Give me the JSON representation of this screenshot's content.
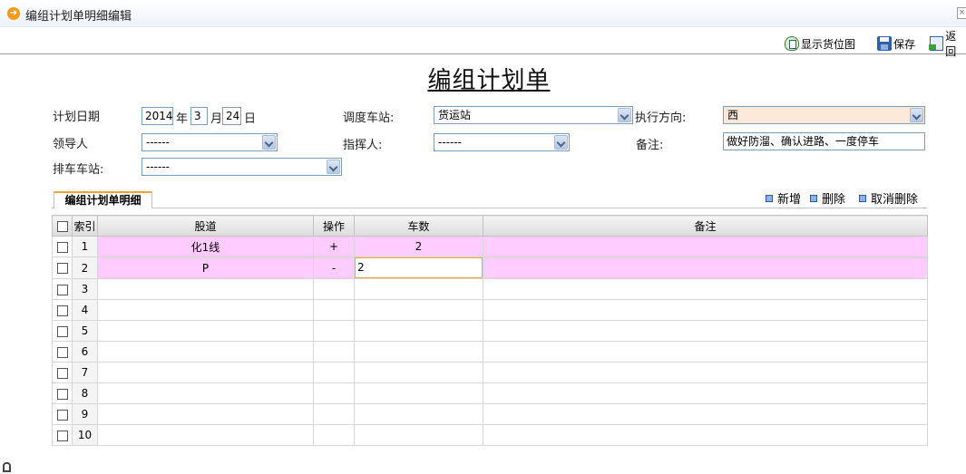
{
  "window": {
    "title": "编组计划单明细编辑"
  },
  "toolbar": {
    "show_map_label": "显示货位图",
    "save_label": "保存",
    "back_label": "返回"
  },
  "page": {
    "title": "编组计划单"
  },
  "form": {
    "plan_date_label": "计划日期",
    "year": "2014",
    "year_unit": "年",
    "month": "3",
    "month_unit": "月",
    "day": "24",
    "day_unit": "日",
    "dispatch_station_label": "调度车站:",
    "dispatch_station_value": "货运站",
    "direction_label": "执行方向:",
    "direction_value": "西",
    "leader_label": "领导人",
    "leader_value": "------",
    "commander_label": "指挥人:",
    "commander_value": "------",
    "remark_label": "备注:",
    "remark_value": "做好防溜、确认进路、一度停车",
    "arrange_station_label": "排车车站:",
    "arrange_station_value": "------"
  },
  "detail": {
    "tab_label": "编组计划单明细",
    "actions": {
      "add": "新增",
      "delete": "删除",
      "undo_delete": "取消删除"
    },
    "columns": {
      "index": "索引",
      "track": "股道",
      "operation": "操作",
      "car_count": "车数",
      "remark": "备注"
    },
    "rows": [
      {
        "index": "1",
        "track": "化1线",
        "operation": "+",
        "car_count": "2",
        "remark": ""
      },
      {
        "index": "2",
        "track": "P",
        "operation": "-",
        "car_count": "2",
        "remark": ""
      },
      {
        "index": "3",
        "track": "",
        "operation": "",
        "car_count": "",
        "remark": ""
      },
      {
        "index": "4",
        "track": "",
        "operation": "",
        "car_count": "",
        "remark": ""
      },
      {
        "index": "5",
        "track": "",
        "operation": "",
        "car_count": "",
        "remark": ""
      },
      {
        "index": "6",
        "track": "",
        "operation": "",
        "car_count": "",
        "remark": ""
      },
      {
        "index": "7",
        "track": "",
        "operation": "",
        "car_count": "",
        "remark": ""
      },
      {
        "index": "8",
        "track": "",
        "operation": "",
        "car_count": "",
        "remark": ""
      },
      {
        "index": "9",
        "track": "",
        "operation": "",
        "car_count": "",
        "remark": ""
      },
      {
        "index": "10",
        "track": "",
        "operation": "",
        "car_count": "",
        "remark": ""
      }
    ]
  },
  "colors": {
    "highlight_row": "#ffccff",
    "direction_field": "#fde9d9",
    "accent_orange": "#f3a233"
  }
}
